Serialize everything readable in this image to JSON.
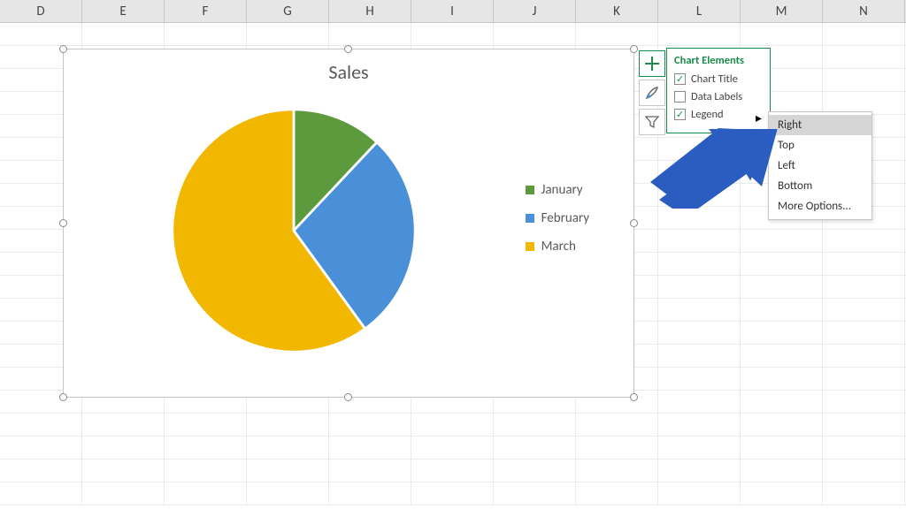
{
  "columns": [
    "D",
    "E",
    "F",
    "G",
    "H",
    "I",
    "J",
    "K",
    "L",
    "M",
    "N"
  ],
  "chart_title": "Sales",
  "legend": {
    "items": [
      {
        "label": "January",
        "color": "#5d9a3e"
      },
      {
        "label": "February",
        "color": "#4a90d9"
      },
      {
        "label": "March",
        "color": "#f2b700"
      }
    ]
  },
  "elements_panel": {
    "title": "Chart Elements",
    "options": [
      {
        "label": "Chart Title",
        "checked": true
      },
      {
        "label": "Data Labels",
        "checked": false
      },
      {
        "label": "Legend",
        "checked": true
      }
    ]
  },
  "legend_submenu": {
    "items": [
      "Right",
      "Top",
      "Left",
      "Bottom",
      "More Options..."
    ],
    "selected": "Right"
  },
  "chart_data": {
    "type": "pie",
    "title": "Sales",
    "categories": [
      "January",
      "February",
      "March"
    ],
    "values": [
      12,
      28,
      60
    ],
    "colors": [
      "#5d9a3e",
      "#4a90d9",
      "#f2b700"
    ],
    "legend_position": "right"
  }
}
